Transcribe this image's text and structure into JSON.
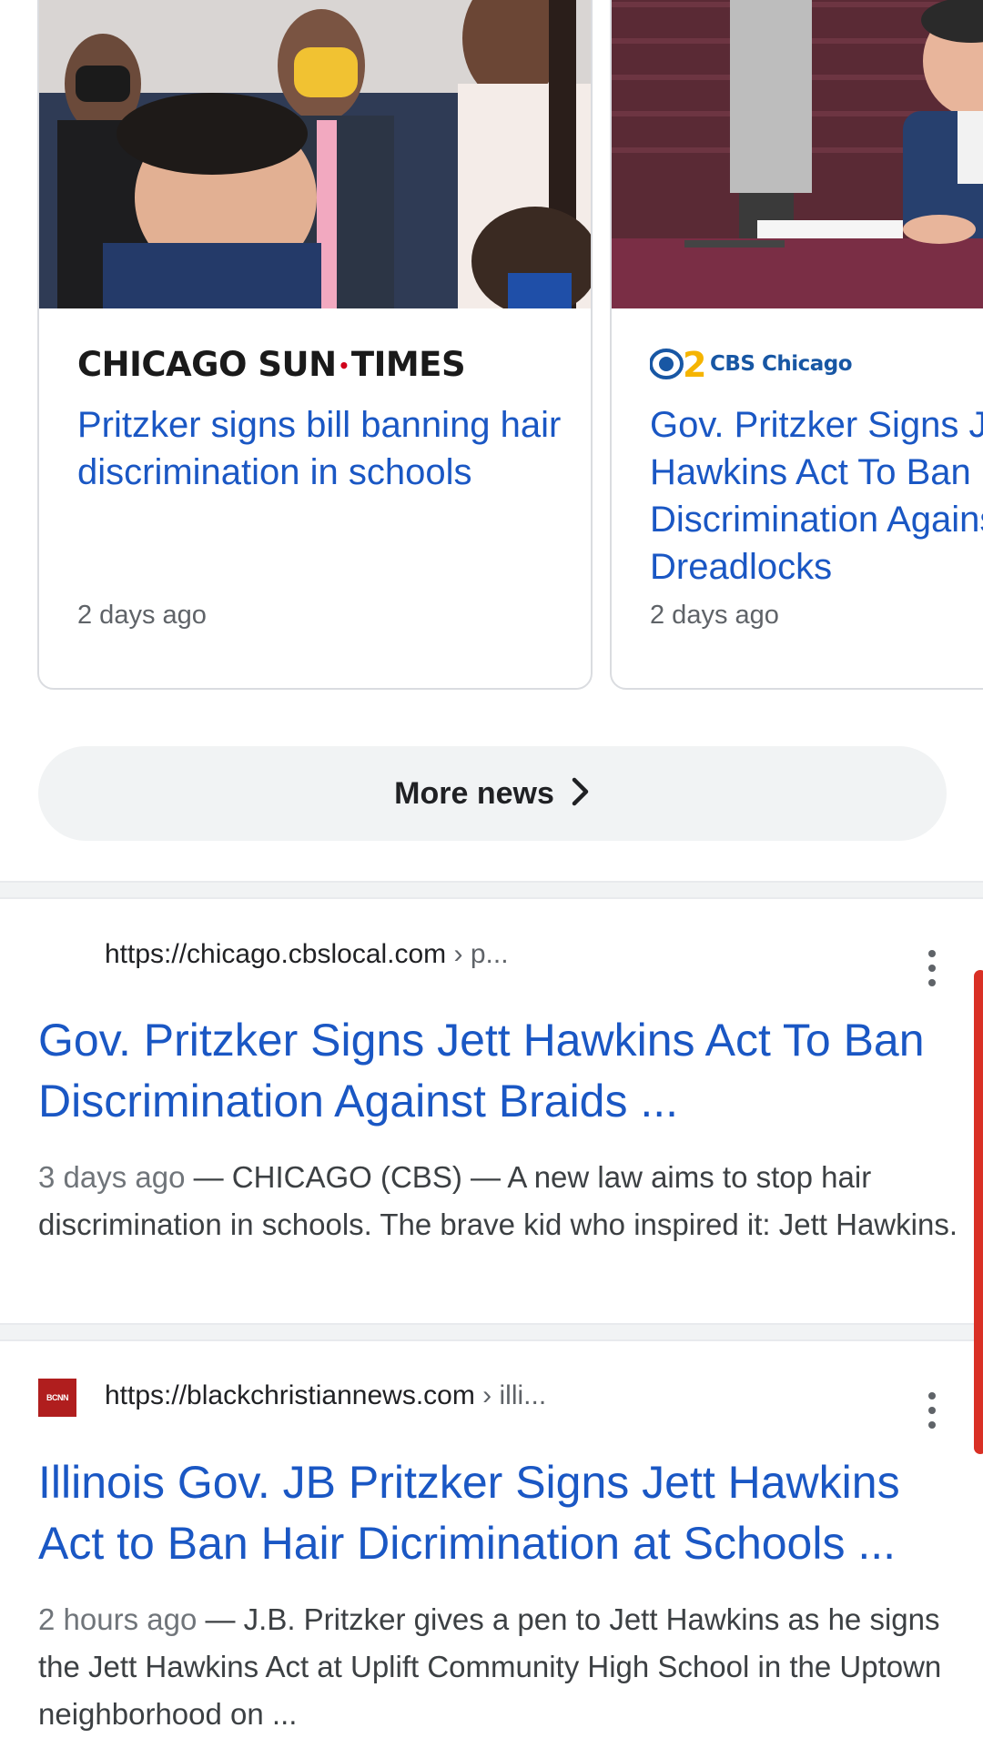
{
  "news_cards": [
    {
      "publisher": "CHICAGO SUN-TIMES",
      "publisher_left": "CHICAGO SUN",
      "publisher_right": "TIMES",
      "headline": "Pritzker signs bill banning hair discrimination in schools",
      "age": "2 days ago"
    },
    {
      "publisher": "CBS Chicago",
      "headline": "Gov. Pritzker Signs Jett Hawkins Act To Ban Discrimination Against Braids, Dreadlocks",
      "age": "2 days ago"
    }
  ],
  "more_news": {
    "label": "More news"
  },
  "results": [
    {
      "url": "https://chicago.cbslocal.com",
      "crumb": " › p...",
      "title": "Gov. Pritzker Signs Jett Hawkins Act To Ban Discrimination Against Braids ...",
      "date": "3 days ago",
      "snippet": " — CHICAGO (CBS) — A new law aims to stop hair discrimination in schools. The brave kid who inspired it: Jett Hawkins."
    },
    {
      "url": "https://blackchristiannews.com",
      "crumb": " › illi...",
      "title": "Illinois Gov. JB Pritzker Signs Jett Hawkins Act to Ban Hair Dicrimination at Schools ...",
      "date": "2 hours ago",
      "snippet": " — J.B. Pritzker gives a pen to Jett Hawkins as he signs the Jett Hawkins Act at Uplift Community High School in the Uptown neighborhood on ..."
    }
  ],
  "favicon_text": "BCNN",
  "colors": {
    "link": "#1a57c4",
    "accent_red": "#d93025",
    "chip_bg": "#f1f3f4"
  },
  "icons": [
    "chevron-right-icon",
    "more-vert-icon"
  ]
}
